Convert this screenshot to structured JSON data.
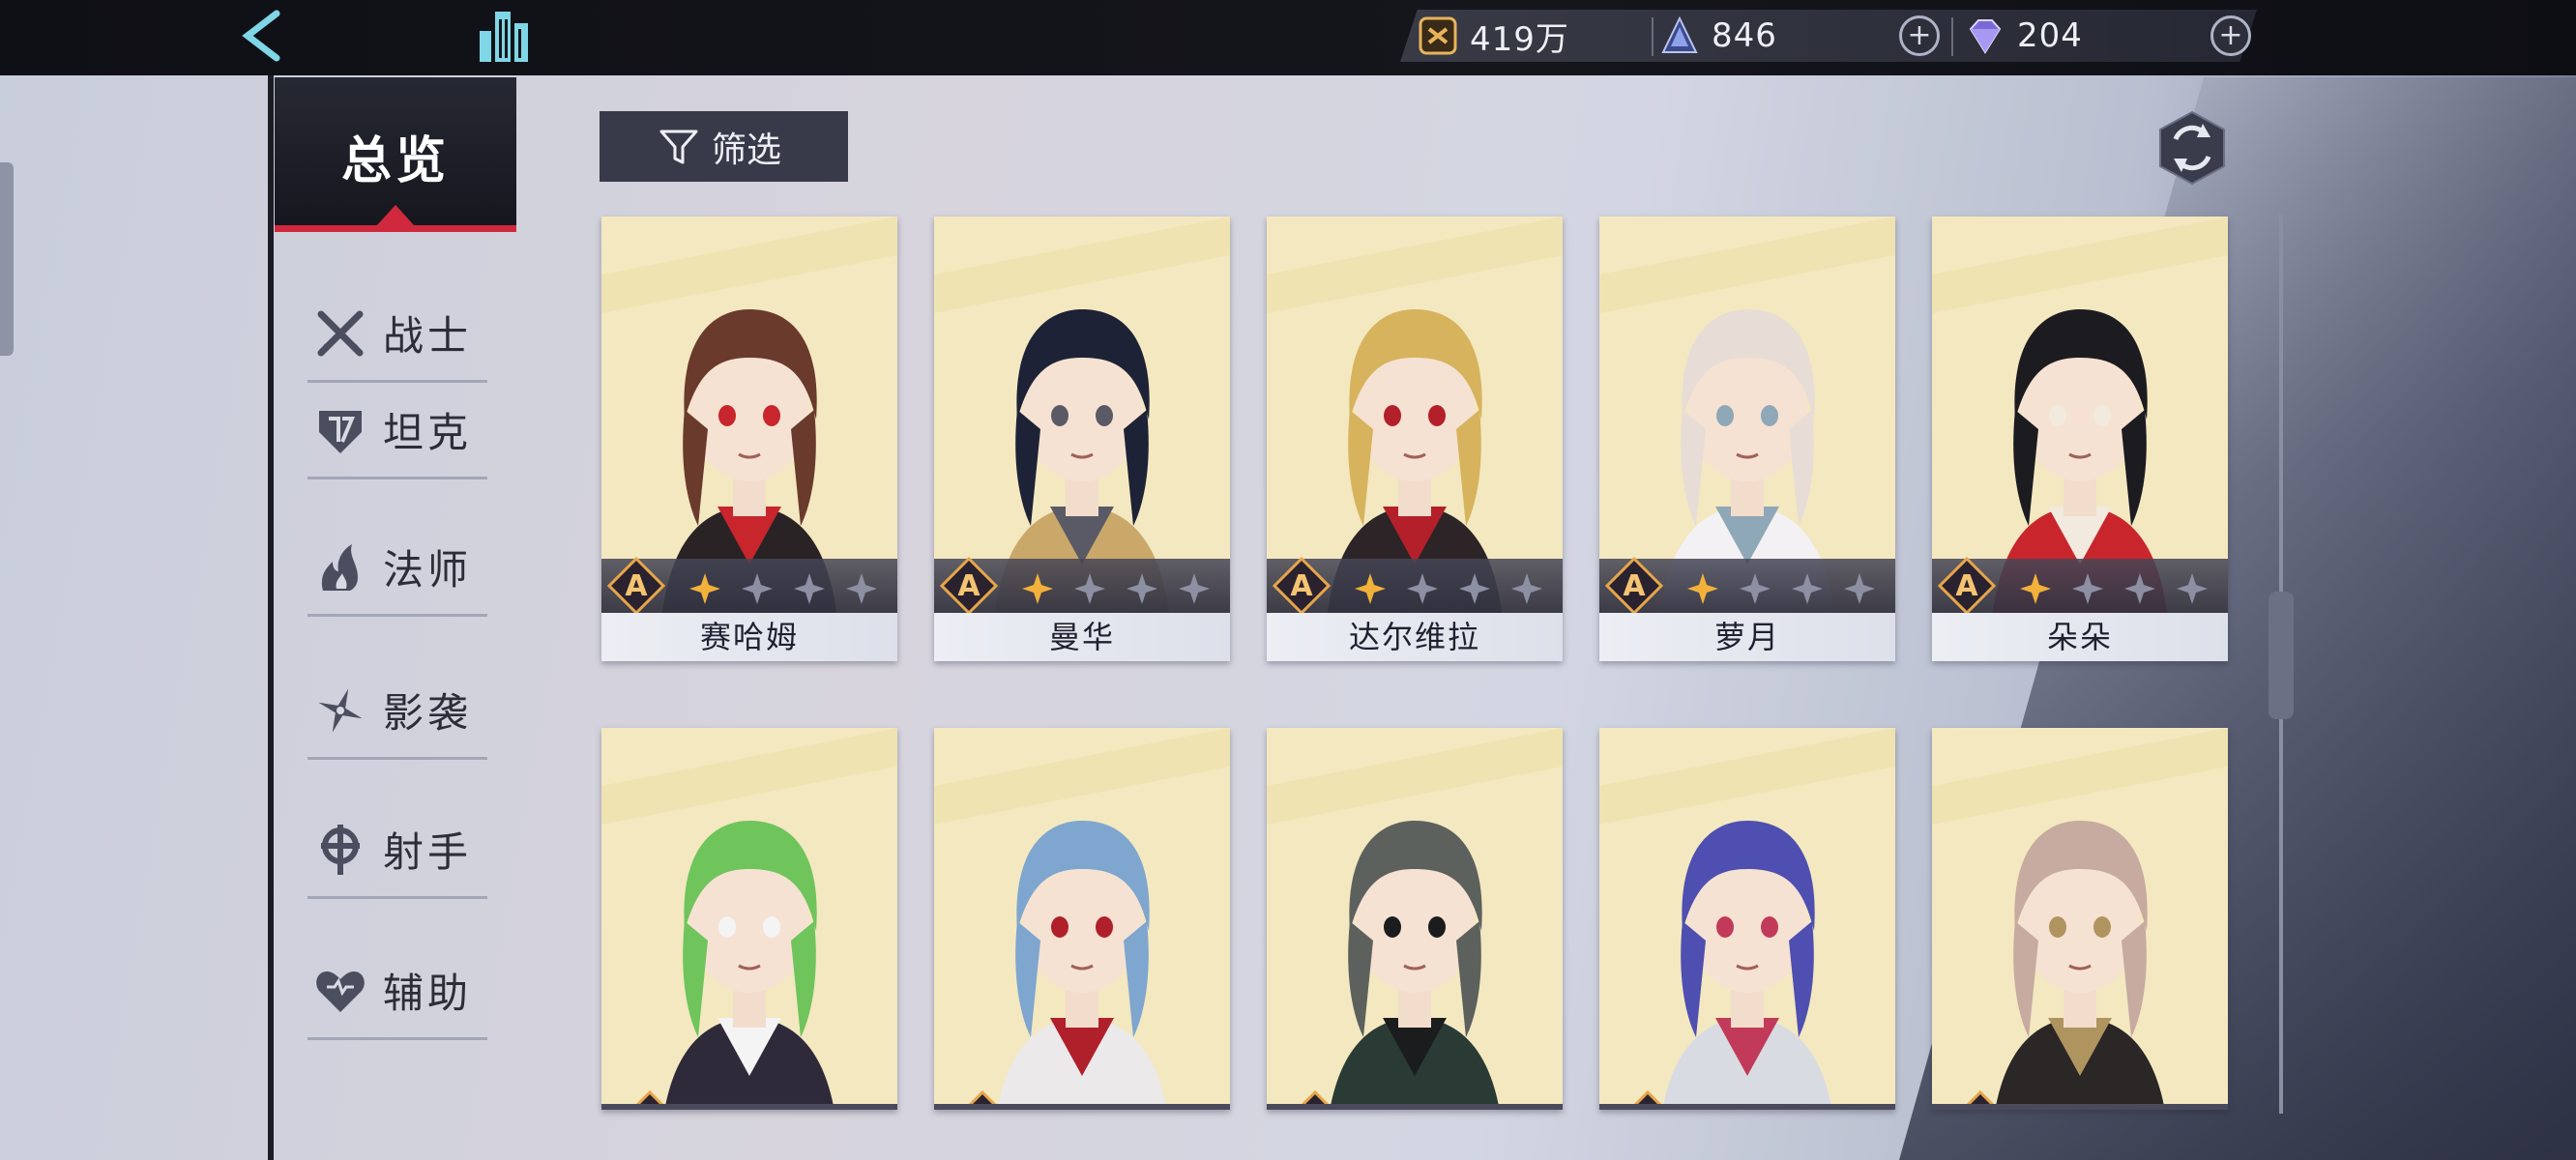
{
  "resources": {
    "gold": "419万",
    "stamina": "846",
    "crystal": "204"
  },
  "sidebar": {
    "overview": "总览",
    "items": [
      {
        "label": "战士",
        "icon": "crossed-swords-icon"
      },
      {
        "label": "坦克",
        "icon": "shield-helmet-icon"
      },
      {
        "label": "法师",
        "icon": "flame-icon"
      },
      {
        "label": "影袭",
        "icon": "shuriken-icon"
      },
      {
        "label": "射手",
        "icon": "crosshair-icon"
      },
      {
        "label": "辅助",
        "icon": "heart-icon"
      }
    ]
  },
  "filter_label": "筛选",
  "rank_letter": "A",
  "characters": [
    {
      "name": "赛哈姆",
      "rank": "A",
      "stars": 1,
      "palette": {
        "hair": "#6a3a2c",
        "cloth": "#2a2326",
        "accent": "#c8252c"
      }
    },
    {
      "name": "曼华",
      "rank": "A",
      "stars": 1,
      "palette": {
        "hair": "#1e2236",
        "cloth": "#c9a86a",
        "accent": "#5a5a66"
      }
    },
    {
      "name": "达尔维拉",
      "rank": "A",
      "stars": 1,
      "palette": {
        "hair": "#d7b35e",
        "cloth": "#2c2426",
        "accent": "#b3202a"
      }
    },
    {
      "name": "萝月",
      "rank": "A",
      "stars": 1,
      "palette": {
        "hair": "#e7ddd6",
        "cloth": "#f3f1f4",
        "accent": "#8fa8b8"
      }
    },
    {
      "name": "朵朵",
      "rank": "A",
      "stars": 1,
      "palette": {
        "hair": "#1c1b20",
        "cloth": "#c8262c",
        "accent": "#f2eadf"
      }
    },
    {
      "palette": {
        "hair": "#6fc45c",
        "cloth": "#2e2a3a",
        "accent": "#f4f4f4"
      }
    },
    {
      "palette": {
        "hair": "#7fa6cf",
        "cloth": "#ece9ea",
        "accent": "#b0202a"
      }
    },
    {
      "palette": {
        "hair": "#5d615e",
        "cloth": "#2a3a34",
        "accent": "#1b1c1e"
      }
    },
    {
      "palette": {
        "hair": "#4e4fb0",
        "cloth": "#d9dbe2",
        "accent": "#c23a5a"
      }
    },
    {
      "palette": {
        "hair": "#c7aaa0",
        "cloth": "#2a2726",
        "accent": "#b09460"
      }
    }
  ],
  "colors": {
    "accent_red": "#d0293d",
    "star_gold": "#f2b13a",
    "star_empty": "#8d8fa3"
  }
}
